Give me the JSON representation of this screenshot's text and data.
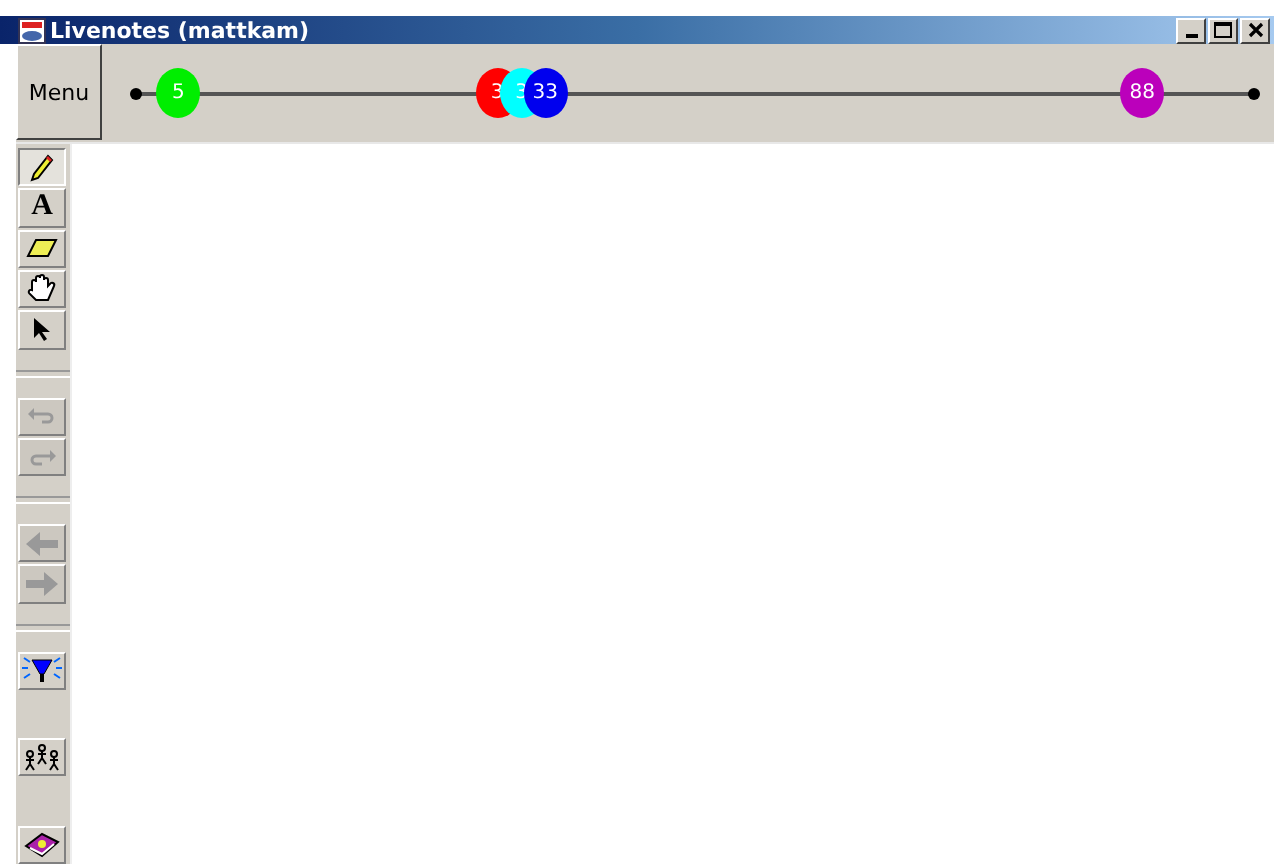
{
  "window": {
    "title": "Livenotes (mattkam)"
  },
  "menu_button": "Menu",
  "timeline": {
    "markers": [
      {
        "label": "5",
        "color": "#00ee00",
        "level": 0.038
      },
      {
        "label": "3",
        "color": "#ff0000",
        "level": 0.323
      },
      {
        "label": "3",
        "color": "#00ffff",
        "level": 0.345
      },
      {
        "label": "33",
        "color": "#0000ee",
        "level": 0.366
      },
      {
        "label": "88",
        "color": "#bb00bb",
        "level": 0.9
      }
    ]
  },
  "tools": [
    {
      "kind": "pen",
      "selected": true
    },
    {
      "kind": "text",
      "label": "A",
      "selected": false
    },
    {
      "kind": "eraser",
      "selected": false
    },
    {
      "kind": "hand",
      "selected": false
    },
    {
      "kind": "pointer",
      "selected": false
    },
    {
      "kind": "separator"
    },
    {
      "kind": "undo",
      "disabled": true
    },
    {
      "kind": "redo",
      "disabled": true
    },
    {
      "kind": "separator"
    },
    {
      "kind": "back",
      "disabled": true
    },
    {
      "kind": "forward",
      "disabled": true
    },
    {
      "kind": "separator"
    },
    {
      "kind": "spotlight",
      "disabled": false
    },
    {
      "kind": "gap"
    },
    {
      "kind": "people",
      "disabled": false
    },
    {
      "kind": "gap"
    },
    {
      "kind": "book",
      "disabled": false
    }
  ]
}
